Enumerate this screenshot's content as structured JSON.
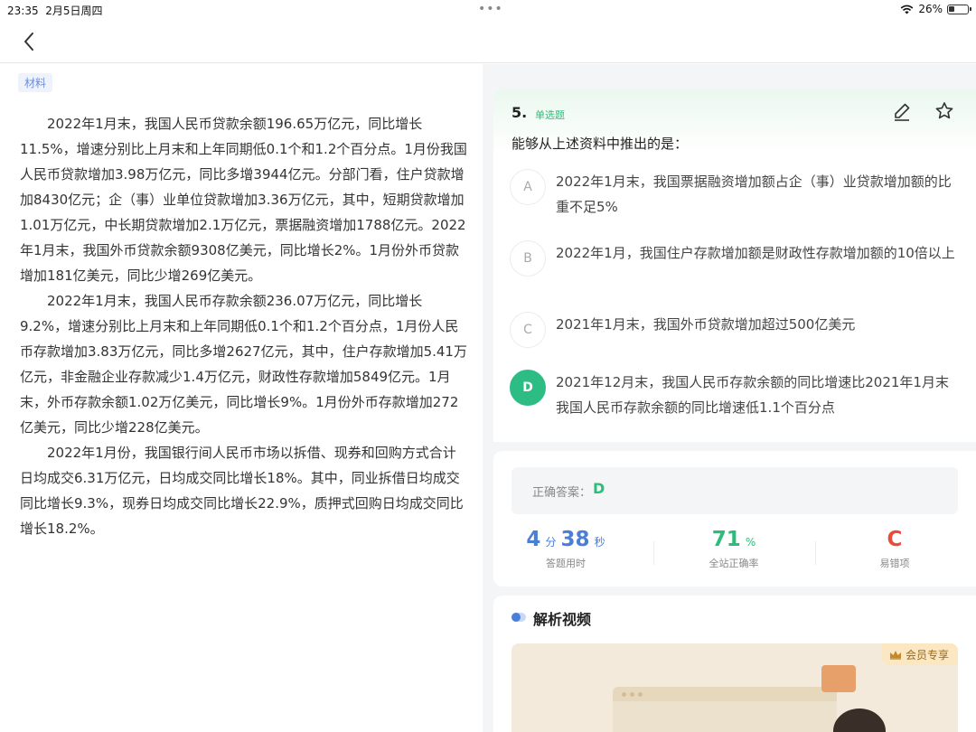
{
  "status_bar": {
    "time": "23:35",
    "date": "2月5日周四",
    "battery_percent": "26%",
    "icons": [
      "wifi-icon",
      "battery-icon"
    ]
  },
  "nav": {
    "back_icon": "chevron-left-icon"
  },
  "material": {
    "tag": "材料",
    "paragraphs": [
      "2022年1月末，我国人民币贷款余额196.65万亿元，同比增长11.5%，增速分别比上月末和上年同期低0.1个和1.2个百分点。1月份我国人民币贷款增加3.98万亿元，同比多增3944亿元。分部门看，住户贷款增加8430亿元；企（事）业单位贷款增加3.36万亿元，其中，短期贷款增加1.01万亿元，中长期贷款增加2.1万亿元，票据融资增加1788亿元。2022年1月末，我国外币贷款余额9308亿美元，同比增长2%。1月份外币贷款增加181亿美元，同比少增269亿美元。",
      "2022年1月末，我国人民币存款余额236.07万亿元，同比增长9.2%，增速分别比上月末和上年同期低0.1个和1.2个百分点，1月份人民币存款增加3.83万亿元，同比多增2627亿元，其中，住户存款增加5.41万亿元，非金融企业存款减少1.4万亿元，财政性存款增加5849亿元。1月末，外币存款余额1.02万亿美元，同比增长9%。1月份外币存款增加272亿美元，同比少增228亿美元。",
      "2022年1月份，我国银行间人民币市场以拆借、现券和回购方式合计日均成交6.31万亿元，日均成交同比增长18%。其中，同业拆借日均成交同比增长9.3%，现券日均成交同比增长22.9%，质押式回购日均成交同比增长18.2%。"
    ]
  },
  "question": {
    "number": "5.",
    "type": "单选题",
    "stem": "能够从上述资料中推出的是：",
    "icons": [
      "edit-icon",
      "star-icon"
    ],
    "options": [
      {
        "letter": "A",
        "text": "2022年1月末，我国票据融资增加额占企（事）业贷款增加额的比重不足5%",
        "selected": false
      },
      {
        "letter": "B",
        "text": "2022年1月，我国住户存款增加额是财政性存款增加额的10倍以上",
        "selected": false
      },
      {
        "letter": "C",
        "text": "2021年1月末，我国外币贷款增加超过500亿美元",
        "selected": false
      },
      {
        "letter": "D",
        "text": "2021年12月末，我国人民币存款余额的同比增速比2021年1月末我国人民币存款余额的同比增速低1.1个百分点",
        "selected": true
      }
    ]
  },
  "answer": {
    "correct_label": "正确答案：",
    "correct_value": "D",
    "time_minutes": "4",
    "time_min_unit": "分",
    "time_seconds": "38",
    "time_sec_unit": "秒",
    "time_label": "答题用时",
    "accuracy_value": "71",
    "accuracy_unit": "%",
    "accuracy_label": "全站正确率",
    "common_wrong_value": "C",
    "common_wrong_label": "易错项"
  },
  "video": {
    "title": "解析视频",
    "vip_badge": "会员专享",
    "icons": [
      "toggle-icon",
      "crown-icon"
    ]
  },
  "colors": {
    "accent_green": "#2dbd84",
    "accent_blue": "#4a7fd6",
    "error_red": "#e74c3c"
  }
}
